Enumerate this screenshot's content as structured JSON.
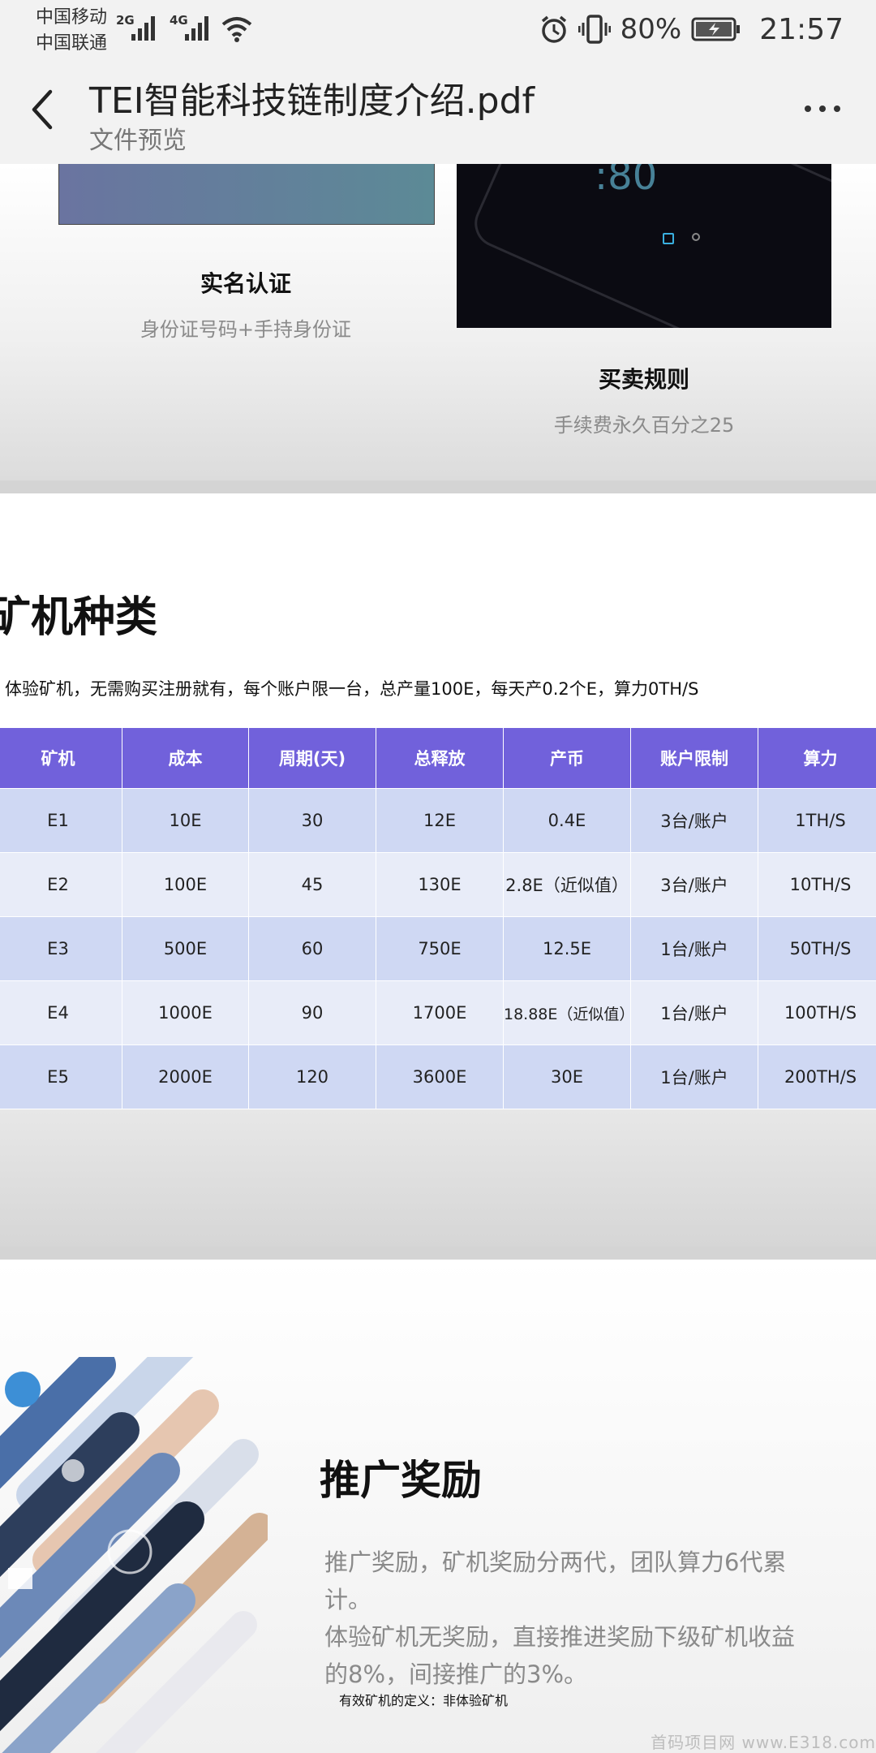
{
  "status_bar": {
    "carrier_1": "中国移动",
    "carrier_2": "中国联通",
    "net_1": "2G",
    "net_2": "4G",
    "battery_pct": "80%",
    "time": "21:57"
  },
  "header": {
    "title": "TEI智能科技链制度介绍.pdf",
    "subtitle": "文件预览"
  },
  "page1": {
    "left_caption_title": "实名认证",
    "left_caption_sub": "身份证号码+手持身份证",
    "right_caption_title": "买卖规则",
    "right_caption_sub": "手续费永久百分之25"
  },
  "page2": {
    "heading": "矿机种类",
    "note": "体验矿机，无需购买注册就有，每个账户限一台，总产量100E，每天产0.2个E，算力0TH/S",
    "table": {
      "columns": [
        "矿机",
        "成本",
        "周期(天)",
        "总释放",
        "产币",
        "账户限制",
        "算力"
      ],
      "rows": [
        [
          "E1",
          "10E",
          "30",
          "12E",
          "0.4E",
          "3台/账户",
          "1TH/S"
        ],
        [
          "E2",
          "100E",
          "45",
          "130E",
          "2.8E（近似值）",
          "3台/账户",
          "10TH/S"
        ],
        [
          "E3",
          "500E",
          "60",
          "750E",
          "12.5E",
          "1台/账户",
          "50TH/S"
        ],
        [
          "E4",
          "1000E",
          "90",
          "1700E",
          "18.88E（近似值）",
          "1台/账户",
          "100TH/S"
        ],
        [
          "E5",
          "2000E",
          "120",
          "3600E",
          "30E",
          "1台/账户",
          "200TH/S"
        ]
      ]
    }
  },
  "page3": {
    "heading": "推广奖励",
    "body_line_1": "推广奖励，矿机奖励分两代，团队算力6代累计。",
    "body_line_2": "体验矿机无奖励，直接推进奖励下级矿机收益",
    "body_line_3": "的8%，间接推广的3%。",
    "note": "有效矿机的定义：非体验矿机"
  },
  "watermark": "首码项目网 www.E318.com"
}
